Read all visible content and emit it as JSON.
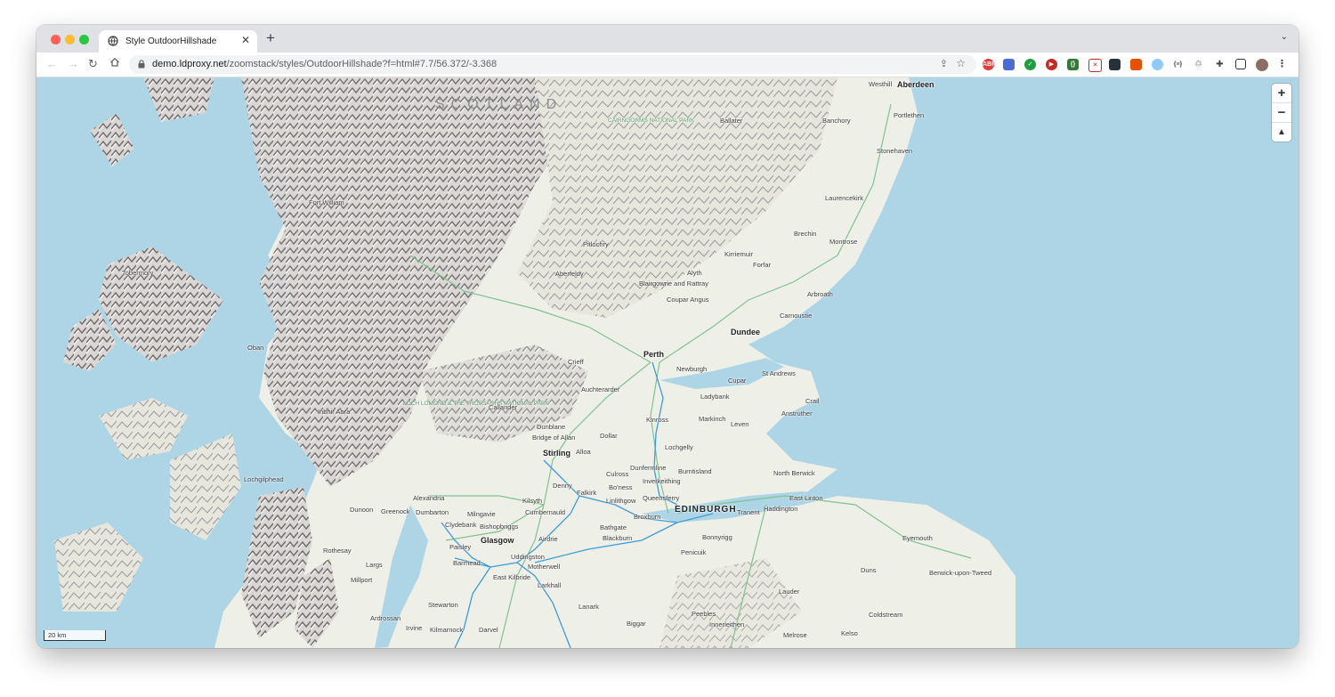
{
  "browser": {
    "tab_title": "Style OutdoorHillshade",
    "url_host": "demo.ldproxy.net",
    "url_path": "/zoomstack/styles/OutdoorHillshade?f=html#7.7/56.372/-3.368",
    "new_tab_label": "+",
    "extensions": [
      "ABP"
    ]
  },
  "map": {
    "region_label": "SCOTLAND",
    "park_labels": [
      "Cairngorms National Park",
      "Loch Lomond & The Trossachs National Park"
    ],
    "major_cities": [
      "Aberdeen",
      "Dundee",
      "Perth",
      "Stirling",
      "Glasgow",
      "EDINBURGH"
    ],
    "places": {
      "westhill": "Westhill",
      "portlethen": "Portlethen",
      "ballater": "Ballater",
      "banchory": "Banchory",
      "stonehaven": "Stonehaven",
      "laurencekirk": "Laurencekirk",
      "brechin": "Brechin",
      "montrose": "Montrose",
      "kirriemuir": "Kirriemuir",
      "forfar": "Forfar",
      "arbroath": "Arbroath",
      "carnoustie": "Carnoustie",
      "alyth": "Alyth",
      "blairgowrie": "Blairgowrie and Rattray",
      "coupar_angus": "Coupar Angus",
      "pitlochry": "Pitlochry",
      "aberfeldy": "Aberfeldy",
      "fort_william": "Fort William",
      "tobermory": "Tobermory",
      "oban": "Oban",
      "crieff": "Crieff",
      "newburgh": "Newburgh",
      "st_andrews": "St Andrews",
      "cupar": "Cupar",
      "ladybank": "Ladybank",
      "crail": "Crail",
      "anstruther": "Anstruther",
      "auchterarder": "Auchterarder",
      "markinch": "Markinch",
      "leven": "Leven",
      "kinross": "Kinross",
      "inbhir_aora": "Inbhir Aora",
      "callander": "Callander",
      "dunblane": "Dunblane",
      "bridge_of_allan": "Bridge of Allan",
      "dollar": "Dollar",
      "alloa": "Alloa",
      "lochgelly": "Lochgelly",
      "dunfermline": "Dunfermline",
      "burntisland": "Burntisland",
      "culross": "Culross",
      "inverkeithing": "Inverkeithing",
      "lochgilphead": "Lochgilphead",
      "denny": "Denny",
      "falkirk": "Falkirk",
      "boness": "Bo'ness",
      "linlithgow": "Linlithgow",
      "queensferry": "Queensferry",
      "north_berwick": "North Berwick",
      "east_linton": "East Linton",
      "haddington": "Haddington",
      "tranent": "Tranent",
      "alexandria": "Alexandria",
      "kilsyth": "Kilsyth",
      "dunoon": "Dunoon",
      "greenock": "Greenock",
      "dumbarton": "Dumbarton",
      "milngavie": "Milngavie",
      "cumbernauld": "Cumbernauld",
      "broxburn": "Broxburn",
      "clydebank": "Clydebank",
      "bishopbriggs": "Bishopbriggs",
      "bathgate": "Bathgate",
      "eyemouth": "Eyemouth",
      "airdrie": "Airdrie",
      "blackburn": "Blackburn",
      "bonnyrigg": "Bonnyrigg",
      "paisley": "Paisley",
      "rothesay": "Rothesay",
      "uddingston": "Uddingston",
      "penicuik": "Penicuik",
      "barrhead": "Barrhead",
      "largs": "Largs",
      "motherwell": "Motherwell",
      "duns": "Duns",
      "berwick": "Berwick-upon-Tweed",
      "millport": "Millport",
      "east_kilbride": "East Kilbride",
      "larkhall": "Larkhall",
      "lauder": "Lauder",
      "stewarton": "Stewarton",
      "lanark": "Lanark",
      "coldstream": "Coldstream",
      "ardrossan": "Ardrossan",
      "peebles": "Peebles",
      "biggar": "Biggar",
      "innerleithen": "Innerleithen",
      "irvine": "Irvine",
      "kilmarnock": "Kilmarnock",
      "darvel": "Darvel",
      "melrose": "Melrose",
      "kelso": "Kelso"
    },
    "zoom_in": "+",
    "zoom_out": "−",
    "compass": "▲",
    "scale_label": "20 km"
  },
  "colors": {
    "sea": "#add5e6",
    "land": "#eef0e8",
    "hills": "#8c8a8d",
    "rail": "#3a9bd9",
    "roads": "#7fc28e"
  }
}
